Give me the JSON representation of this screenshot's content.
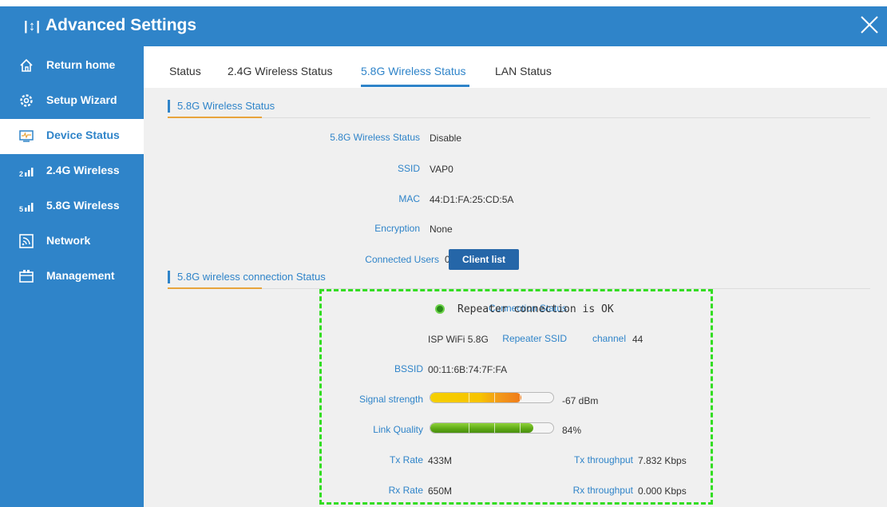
{
  "window": {
    "title": "Advanced Settings",
    "title_icon": "sliders-icon",
    "close_icon": "close-icon"
  },
  "sidebar": {
    "items": [
      {
        "label": "Return home",
        "icon": "home-icon",
        "active": false
      },
      {
        "label": "Setup Wizard",
        "icon": "gear-icon",
        "active": false
      },
      {
        "label": "Device Status",
        "icon": "monitor-icon",
        "active": true
      },
      {
        "label": "2.4G Wireless",
        "icon": "signal-2g-icon",
        "active": false
      },
      {
        "label": "5.8G Wireless",
        "icon": "signal-5g-icon",
        "active": false
      },
      {
        "label": "Network",
        "icon": "network-icon",
        "active": false
      },
      {
        "label": "Management",
        "icon": "management-icon",
        "active": false
      }
    ]
  },
  "tabs": [
    {
      "label": "Status",
      "active": false
    },
    {
      "label": "2.4G Wireless Status",
      "active": false
    },
    {
      "label": "5.8G Wireless Status",
      "active": true
    },
    {
      "label": "LAN Status",
      "active": false
    }
  ],
  "wireless_status": {
    "heading": "5.8G Wireless Status",
    "fields": [
      {
        "label": "5.8G Wireless Status",
        "value": "Disable"
      },
      {
        "label": "SSID",
        "value": "VAP0"
      },
      {
        "label": "MAC",
        "value": "44:D1:FA:25:CD:5A"
      },
      {
        "label": "Encryption",
        "value": "None"
      },
      {
        "label": "Connected Users",
        "value": "0"
      }
    ],
    "client_list_button": "Client list"
  },
  "connection_status": {
    "heading": "5.8G wireless connection Status",
    "connection": {
      "label": "Connection Status",
      "value": "Repeater connection is OK"
    },
    "repeater_ssid": {
      "label": "Repeater SSID",
      "value": "ISP WiFi 5.8G"
    },
    "channel": {
      "label": "channel",
      "value": "44"
    },
    "bssid": {
      "label": "BSSID",
      "value": "00:11:6B:74:7F:FA"
    },
    "signal_strength": {
      "label": "Signal strength",
      "value": "-67 dBm",
      "level": 0.74
    },
    "link_quality": {
      "label": "Link Quality",
      "value": "84%",
      "level": 0.84
    },
    "tx_rate": {
      "label": "Tx Rate",
      "value": "433M"
    },
    "tx_throughput": {
      "label": "Tx throughput",
      "value": "7.832 Kbps"
    },
    "rx_rate": {
      "label": "Rx Rate",
      "value": "650M"
    },
    "rx_throughput": {
      "label": "Rx throughput",
      "value": "0.000 Kbps"
    }
  },
  "colors": {
    "primary": "#2f84c9",
    "accent_underline": "#e8a43c",
    "ok_led": "#2a8a1a",
    "highlight": "#33dd22"
  }
}
